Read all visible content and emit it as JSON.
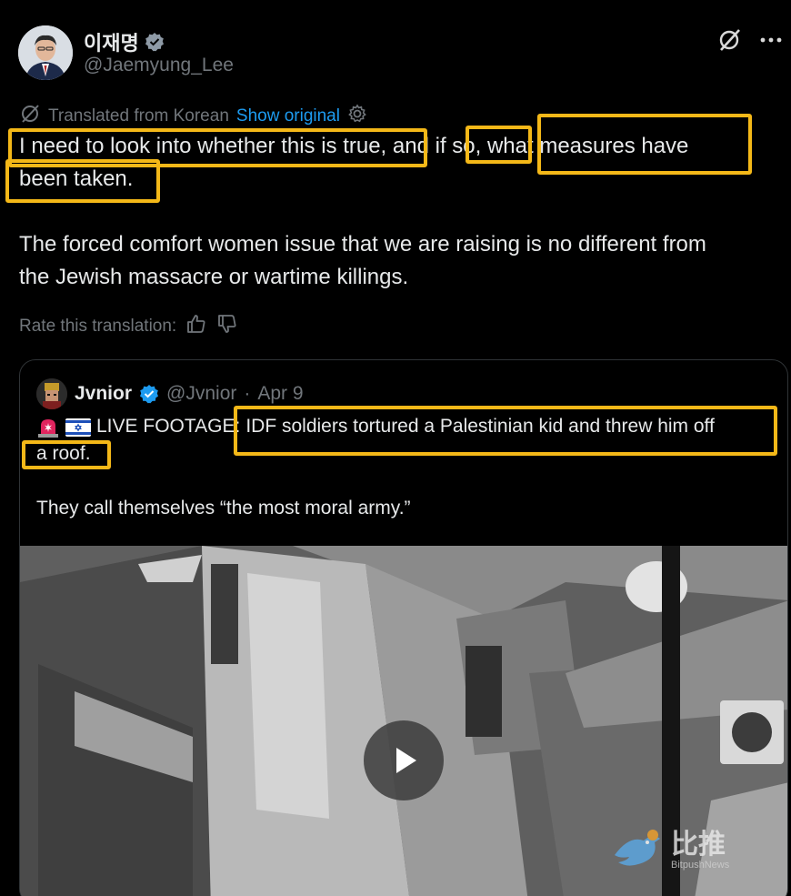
{
  "author": {
    "name": "이재명",
    "handle": "@Jaemyung_Lee"
  },
  "translation": {
    "label": "Translated from Korean",
    "show_original": "Show original",
    "rate_label": "Rate this translation:"
  },
  "post": {
    "paragraph1": "I need to look into whether this is true, and if so, what measures have\nbeen taken.",
    "paragraph2": "The forced comfort women issue that we are raising is no different from\nthe Jewish massacre or wartime killings."
  },
  "quote": {
    "name": "Jvnior",
    "handle": "@Jvnior",
    "separator": "·",
    "date": "Apr 9",
    "line1_prefix": "LIVE FOOTAGE:",
    "line1_rest": "IDF soldiers tortured a Palestinian kid and threw him off",
    "line2": "a roof.",
    "line3": "They call themselves “the most moral army.”"
  },
  "watermark": {
    "text": "比推",
    "subtext": "BitpushNews"
  },
  "colors": {
    "background": "#000000",
    "text": "#e7e9ea",
    "muted": "#71767b",
    "link": "#1d9bf0",
    "highlight": "#f4b818",
    "verified": "#1d9bf0"
  }
}
